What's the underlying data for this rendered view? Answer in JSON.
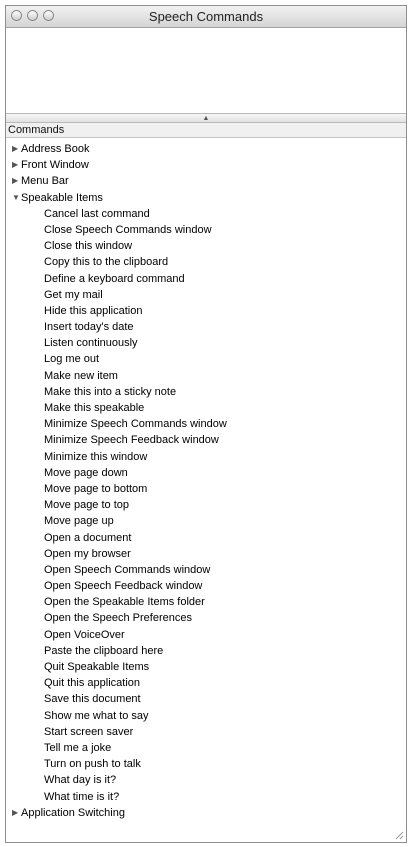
{
  "window": {
    "title": "Speech Commands"
  },
  "header": {
    "label": "Commands"
  },
  "groups": [
    {
      "label": "Address Book",
      "expanded": false
    },
    {
      "label": "Front Window",
      "expanded": false
    },
    {
      "label": "Menu Bar",
      "expanded": false
    },
    {
      "label": "Speakable Items",
      "expanded": true,
      "items": [
        "Cancel last command",
        "Close Speech Commands window",
        "Close this window",
        "Copy this to the clipboard",
        "Define a keyboard command",
        "Get my mail",
        "Hide this application",
        "Insert today's date",
        "Listen continuously",
        "Log me out",
        "Make new item",
        "Make this into a sticky note",
        "Make this speakable",
        "Minimize Speech Commands window",
        "Minimize Speech Feedback window",
        "Minimize this window",
        "Move page down",
        "Move page to bottom",
        "Move page to top",
        "Move page up",
        "Open a document",
        "Open my browser",
        "Open Speech Commands window",
        "Open Speech Feedback window",
        "Open the Speakable Items folder",
        "Open the Speech Preferences",
        "Open VoiceOver",
        "Paste the clipboard here",
        "Quit Speakable Items",
        "Quit this application",
        "Save this document",
        "Show me what to say",
        "Start screen saver",
        "Tell me a joke",
        "Turn on push to talk",
        "What day is it?",
        "What time is it?"
      ]
    },
    {
      "label": "Application Switching",
      "expanded": false
    }
  ],
  "icons": {
    "collapsed": "disclosure-triangle-right-icon",
    "expanded": "disclosure-triangle-down-icon",
    "splitter": "splitter-grip-icon",
    "resize": "resize-grip-icon"
  }
}
